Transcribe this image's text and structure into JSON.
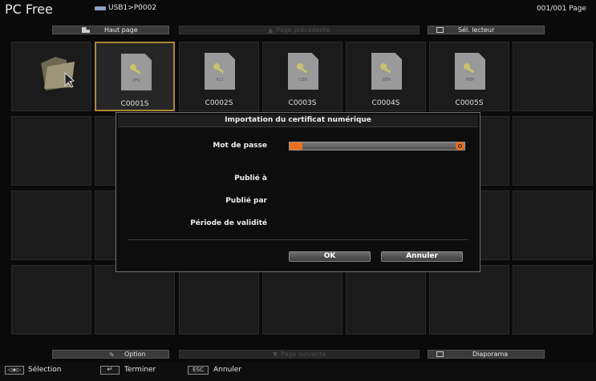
{
  "header": {
    "app_title": "PC Free",
    "path": "USB1>P0002",
    "page_counter": "001/001 Page"
  },
  "top_bar": {
    "home_label": "Haut page",
    "prev_label": "Page précédente",
    "drive_label": "Sél. lecteur"
  },
  "files": [
    {
      "name": "C0001S",
      "ext": "PFX"
    },
    {
      "name": "C0002S",
      "ext": "P12"
    },
    {
      "name": "C0003S",
      "ext": "CER"
    },
    {
      "name": "C0004S",
      "ext": "DER"
    },
    {
      "name": "C0005S",
      "ext": "PEM"
    }
  ],
  "dialog": {
    "title": "Importation du certificat numérique",
    "password_label": "Mot de passe",
    "issued_to_label": "Publié à",
    "issued_by_label": "Publié par",
    "validity_label": "Période de validité",
    "ok_label": "OK",
    "cancel_label": "Annuler"
  },
  "bottom_bar": {
    "option_label": "Option",
    "next_label": "Page suivante",
    "slideshow_label": "Diaporama"
  },
  "footer": {
    "select_label": "Sélection",
    "enter_key": "↵",
    "finish_label": "Terminer",
    "esc_key": "ESC",
    "cancel_label": "Annuler"
  },
  "colors": {
    "accent": "#e8701e",
    "selection_border": "#b08538",
    "background": "#0a0a0a"
  }
}
